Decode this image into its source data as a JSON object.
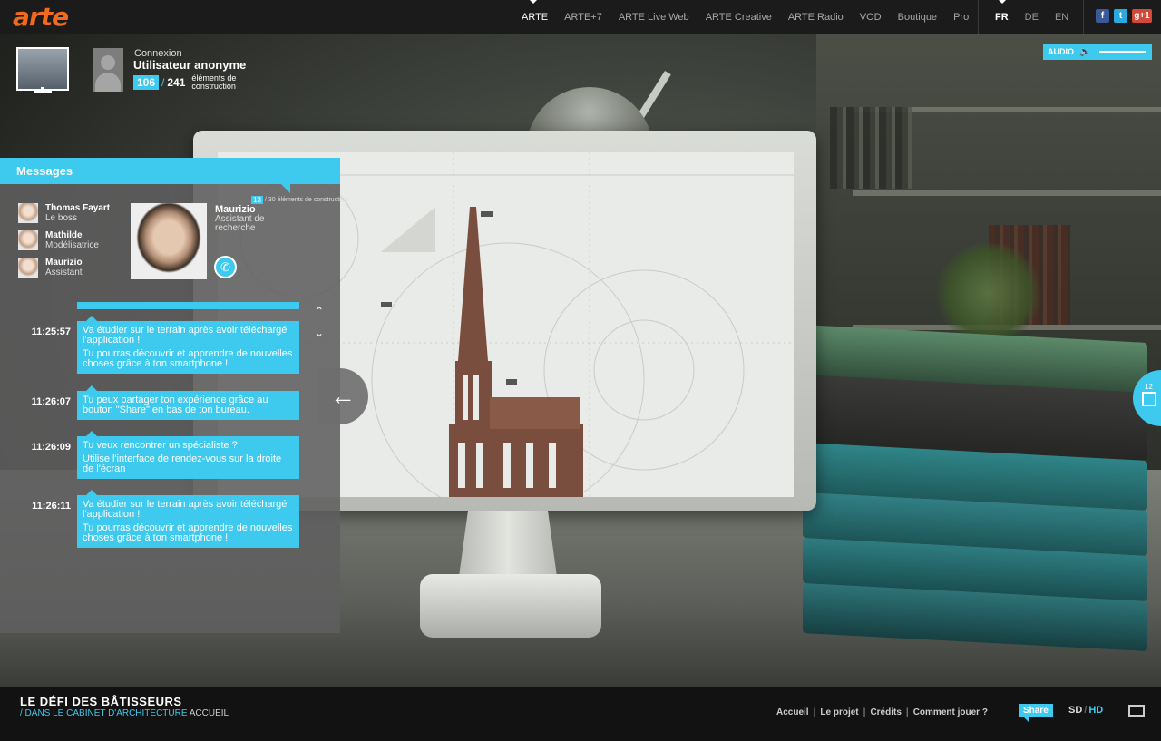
{
  "brand": {
    "logo": "arte",
    "logo_color": "#f26a1b",
    "accent": "#3ec9ee"
  },
  "topnav": {
    "items": [
      "ARTE",
      "ARTE+7",
      "ARTE Live Web",
      "ARTE Creative",
      "ARTE Radio",
      "VOD",
      "Boutique",
      "Pro"
    ],
    "active": "ARTE"
  },
  "languages": {
    "items": [
      "FR",
      "DE",
      "EN"
    ],
    "active": "FR"
  },
  "social": {
    "icons": [
      "facebook-icon",
      "twitter-icon",
      "google-plus-icon"
    ],
    "google_plus": "g+1",
    "facebook": "f",
    "twitter": "t"
  },
  "profile": {
    "login_label": "Connexion",
    "username": "Utilisateur anonyme",
    "elements_current": "106",
    "elements_total": "241",
    "elements_label": "éléments de construction"
  },
  "audio": {
    "label": "AUDIO",
    "volume": 0.85
  },
  "messages": {
    "title": "Messages",
    "contacts": [
      {
        "name": "Thomas Fayart",
        "role": "Le boss"
      },
      {
        "name": "Mathilde",
        "role": "Modélisatrice"
      },
      {
        "name": "Maurizio",
        "role": "Assistant"
      }
    ],
    "selected": {
      "name": "Maurizio",
      "role": "Assistant de recherche",
      "count_current": "13",
      "count_total": "30",
      "count_label": "éléments de construction"
    },
    "items": [
      {
        "time": "11:25:57",
        "lines": [
          "Va étudier sur le terrain après avoir téléchargé l'application !",
          "Tu pourras découvrir et apprendre de nouvelles choses grâce à ton smartphone !"
        ]
      },
      {
        "time": "11:26:07",
        "lines": [
          "Tu peux partager ton expérience grâce au bouton \"Share\" en bas de ton bureau."
        ]
      },
      {
        "time": "11:26:09",
        "lines": [
          "Tu veux rencontrer un spécialiste ?",
          "Utilise l'interface de rendez-vous sur la droite de l'écran"
        ]
      },
      {
        "time": "11:26:11",
        "lines": [
          "Va étudier sur le terrain après avoir téléchargé l'application !",
          "Tu pourras découvrir et apprendre de nouvelles choses grâce à ton smartphone !"
        ]
      }
    ]
  },
  "side_tab": {
    "count": "12"
  },
  "footer": {
    "title": "LE DÉFI DES BÂTISSEURS",
    "breadcrumb_path": "/ DANS LE CABINET D'ARCHITECTURE",
    "breadcrumb_current": "ACCUEIL",
    "links": [
      "Accueil",
      "Le projet",
      "Crédits",
      "Comment jouer ?"
    ],
    "share_label": "Share",
    "quality_sd": "SD",
    "quality_hd": "HD"
  }
}
